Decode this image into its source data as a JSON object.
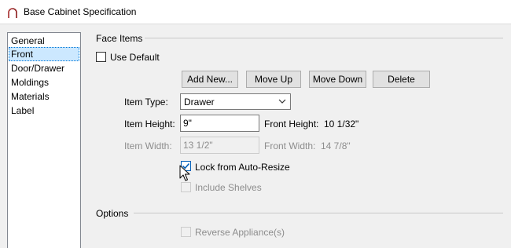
{
  "window": {
    "title": "Base Cabinet Specification",
    "icon": "cabinet-arch-icon"
  },
  "sidebar": {
    "items": [
      {
        "label": "General",
        "selected": false
      },
      {
        "label": "Front",
        "selected": true
      },
      {
        "label": "Door/Drawer",
        "selected": false
      },
      {
        "label": "Moldings",
        "selected": false
      },
      {
        "label": "Materials",
        "selected": false
      },
      {
        "label": "Label",
        "selected": false
      }
    ]
  },
  "face_items": {
    "group_label": "Face Items",
    "use_default": {
      "label": "Use Default",
      "checked": false
    },
    "buttons": {
      "add_new": "Add New...",
      "move_up": "Move Up",
      "move_down": "Move Down",
      "delete": "Delete"
    },
    "item_type": {
      "label": "Item Type:",
      "value": "Drawer"
    },
    "item_height": {
      "label": "Item Height:",
      "value": "9\""
    },
    "front_height": {
      "label": "Front Height:",
      "value": "10 1/32\""
    },
    "item_width": {
      "label": "Item Width:",
      "value": "13 1/2\"",
      "disabled": true
    },
    "front_width": {
      "label": "Front Width:",
      "value": "14 7/8\"",
      "disabled": true
    },
    "lock_auto_resize": {
      "label": "Lock from Auto-Resize",
      "checked": true
    },
    "include_shelves": {
      "label": "Include Shelves",
      "checked": false,
      "disabled": true
    }
  },
  "options": {
    "group_label": "Options",
    "reverse_appliances": {
      "label": "Reverse Appliance(s)",
      "checked": false,
      "disabled": true
    }
  },
  "colors": {
    "selection": "#cce8ff",
    "check_accent": "#005fb8",
    "disabled_text": "#8d8d8d"
  }
}
